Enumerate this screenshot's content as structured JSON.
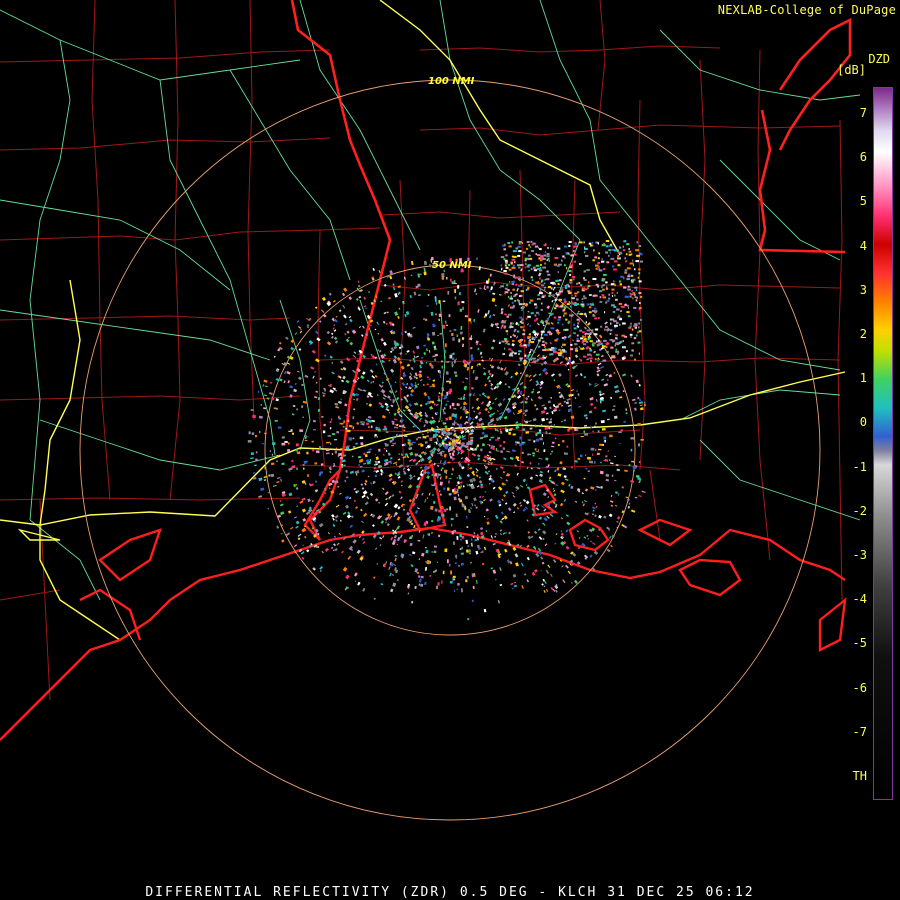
{
  "credit": "NEXLAB-College of DuPage",
  "product_code": "DZD",
  "units": "[dB]",
  "range_rings": [
    {
      "label": "100 NMI"
    },
    {
      "label": "50 NMI"
    }
  ],
  "colorbar": {
    "ticks": [
      "7",
      "6",
      "5",
      "4",
      "3",
      "2",
      "1",
      "0",
      "-1",
      "-2",
      "-3",
      "-4",
      "-5",
      "-6",
      "-7",
      "TH"
    ]
  },
  "footer": "DIFFERENTIAL REFLECTIVITY (ZDR) 0.5 DEG - KLCH 31 DEC 25 06:12",
  "colors": {
    "coast": "#ff1e1e",
    "county": "#a01818",
    "state": "#ff2020",
    "interstate": "#ffff55",
    "highway": "#66dd99",
    "ring": "#e8a070",
    "text": "#ffff55"
  }
}
